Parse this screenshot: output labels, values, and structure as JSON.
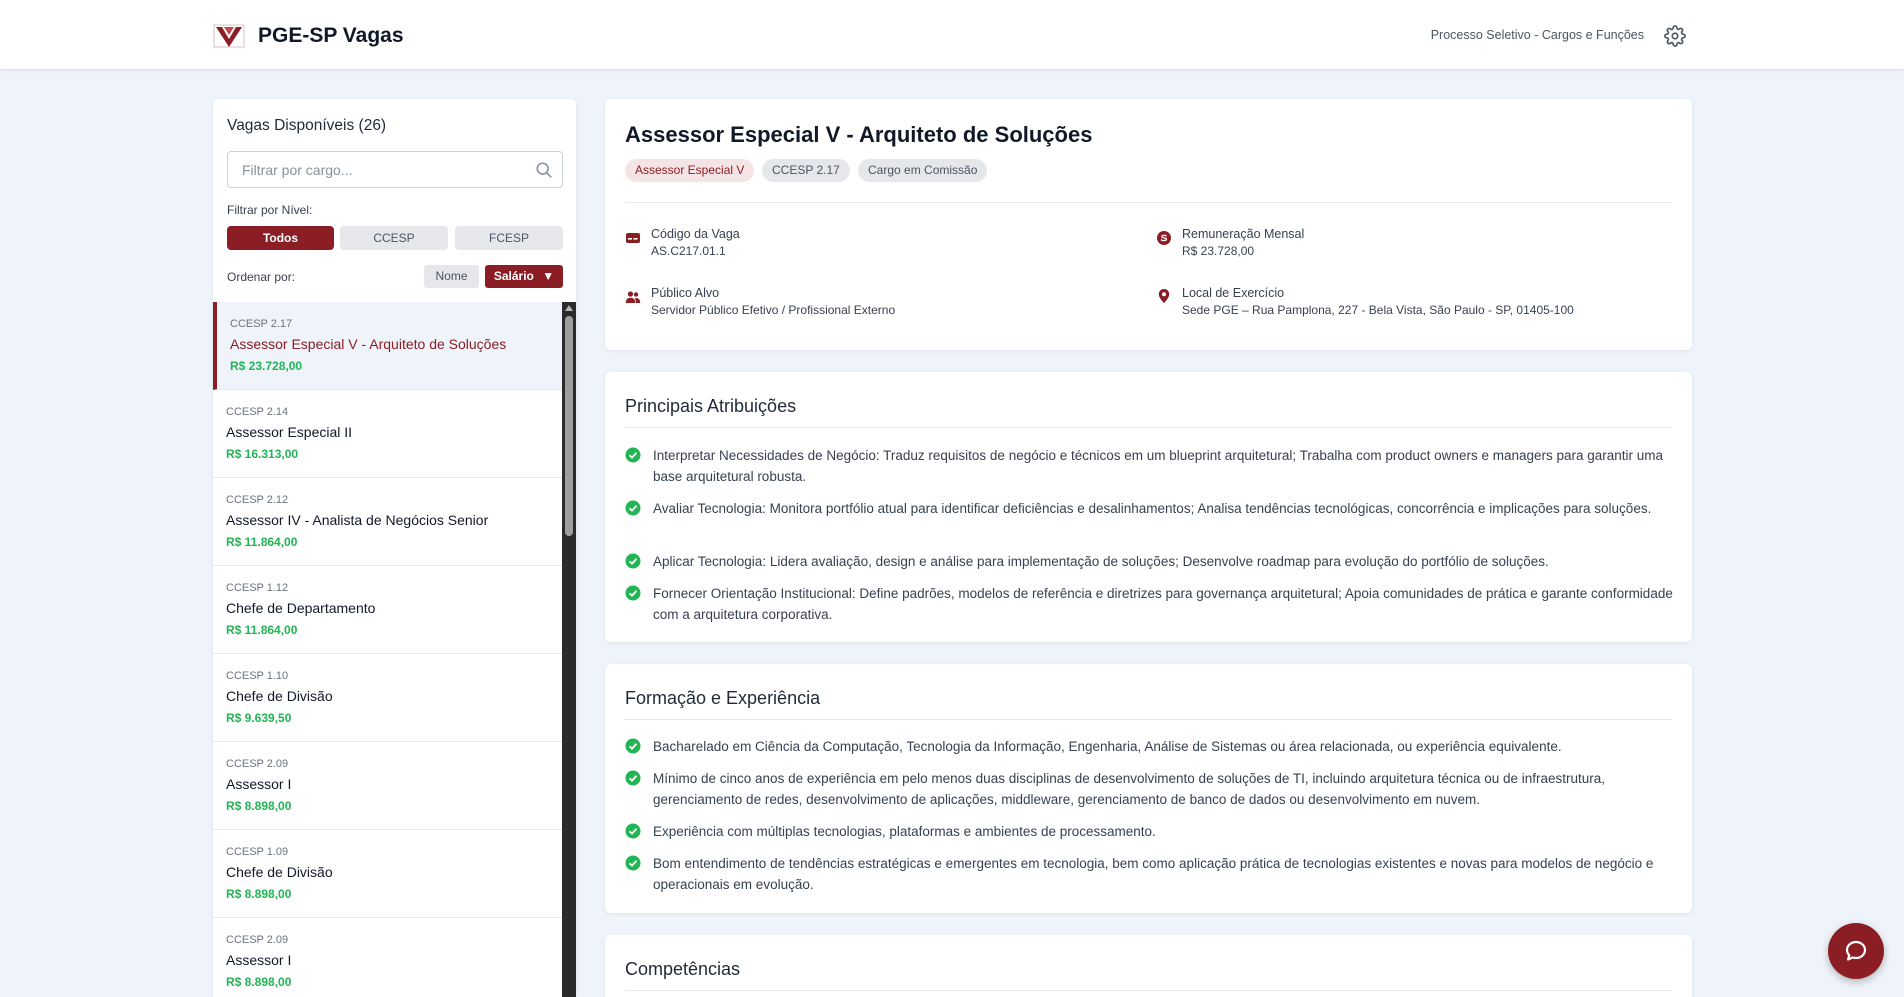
{
  "header": {
    "app_title": "PGE-SP Vagas",
    "link": "Processo Seletivo - Cargos e Funções",
    "brand_color": "#8b1e25"
  },
  "sidebar": {
    "title": "Vagas Disponíveis (26)",
    "search_placeholder": "Filtrar por cargo...",
    "level_label": "Filtrar por Nível:",
    "levels": [
      "Todos",
      "CCESP",
      "FCESP"
    ],
    "active_level": "Todos",
    "sort_label": "Ordenar por:",
    "sort_options": [
      "Nome",
      "Salário"
    ],
    "active_sort": "Salário",
    "sort_arrow": "▼",
    "jobs": [
      {
        "code": "CCESP 2.17",
        "title": "Assessor Especial V - Arquiteto de Soluções",
        "salary": "R$ 23.728,00"
      },
      {
        "code": "CCESP 2.14",
        "title": "Assessor Especial II",
        "salary": "R$ 16.313,00"
      },
      {
        "code": "CCESP 2.12",
        "title": "Assessor IV - Analista de Negócios Senior",
        "salary": "R$ 11.864,00"
      },
      {
        "code": "CCESP 1.12",
        "title": "Chefe de Departamento",
        "salary": "R$ 11.864,00"
      },
      {
        "code": "CCESP 1.10",
        "title": "Chefe de Divisão",
        "salary": "R$ 9.639,50"
      },
      {
        "code": "CCESP 2.09",
        "title": "Assessor I",
        "salary": "R$ 8.898,00"
      },
      {
        "code": "CCESP 1.09",
        "title": "Chefe de Divisão",
        "salary": "R$ 8.898,00"
      },
      {
        "code": "CCESP 2.09",
        "title": "Assessor I",
        "salary": "R$ 8.898,00"
      }
    ]
  },
  "detail": {
    "title": "Assessor Especial V - Arquiteto de Soluções",
    "badges": [
      "Assessor Especial V",
      "CCESP 2.17",
      "Cargo em Comissão"
    ],
    "info": {
      "code_label": "Código da Vaga",
      "code_value": "AS.C217.01.1",
      "salary_label": "Remuneração Mensal",
      "salary_value": "R$ 23.728,00",
      "audience_label": "Público Alvo",
      "audience_value": "Servidor Público Efetivo / Profissional Externo",
      "location_label": "Local de Exercício",
      "location_value": "Sede PGE – Rua Pamplona, 227 - Bela Vista, São Paulo - SP, 01405-100"
    },
    "duties": {
      "title": "Principais Atribuições",
      "items": [
        "Interpretar Necessidades de Negócio: Traduz requisitos de negócio e técnicos em um blueprint arquitetural; Trabalha com product owners e managers para garantir uma base arquitetural robusta.",
        "Avaliar Tecnologia: Monitora portfólio atual para identificar deficiências e desalinhamentos; Analisa tendências tecnológicas, concorrência e implicações para soluções.",
        "Aplicar Tecnologia: Lidera avaliação, design e análise para implementação de soluções; Desenvolve roadmap para evolução do portfólio de soluções.",
        "Fornecer Orientação Institucional: Define padrões, modelos de referência e diretrizes para governança arquitetural; Apoia comunidades de prática e garante conformidade com a arquitetura corporativa."
      ]
    },
    "formation": {
      "title": "Formação e Experiência",
      "items": [
        "Bacharelado em Ciência da Computação, Tecnologia da Informação, Engenharia, Análise de Sistemas ou área relacionada, ou experiência equivalente.",
        "Mínimo de cinco anos de experiência em pelo menos duas disciplinas de desenvolvimento de soluções de TI, incluindo arquitetura técnica ou de infraestrutura, gerenciamento de redes, desenvolvimento de aplicações, middleware, gerenciamento de banco de dados ou desenvolvimento em nuvem.",
        "Experiência com múltiplas tecnologias, plataformas e ambientes de processamento.",
        "Bom entendimento de tendências estratégicas e emergentes em tecnologia, bem como aplicação prática de tecnologias existentes e novas para modelos de negócio e operacionais em evolução."
      ]
    },
    "skills": {
      "title": "Competências"
    }
  }
}
